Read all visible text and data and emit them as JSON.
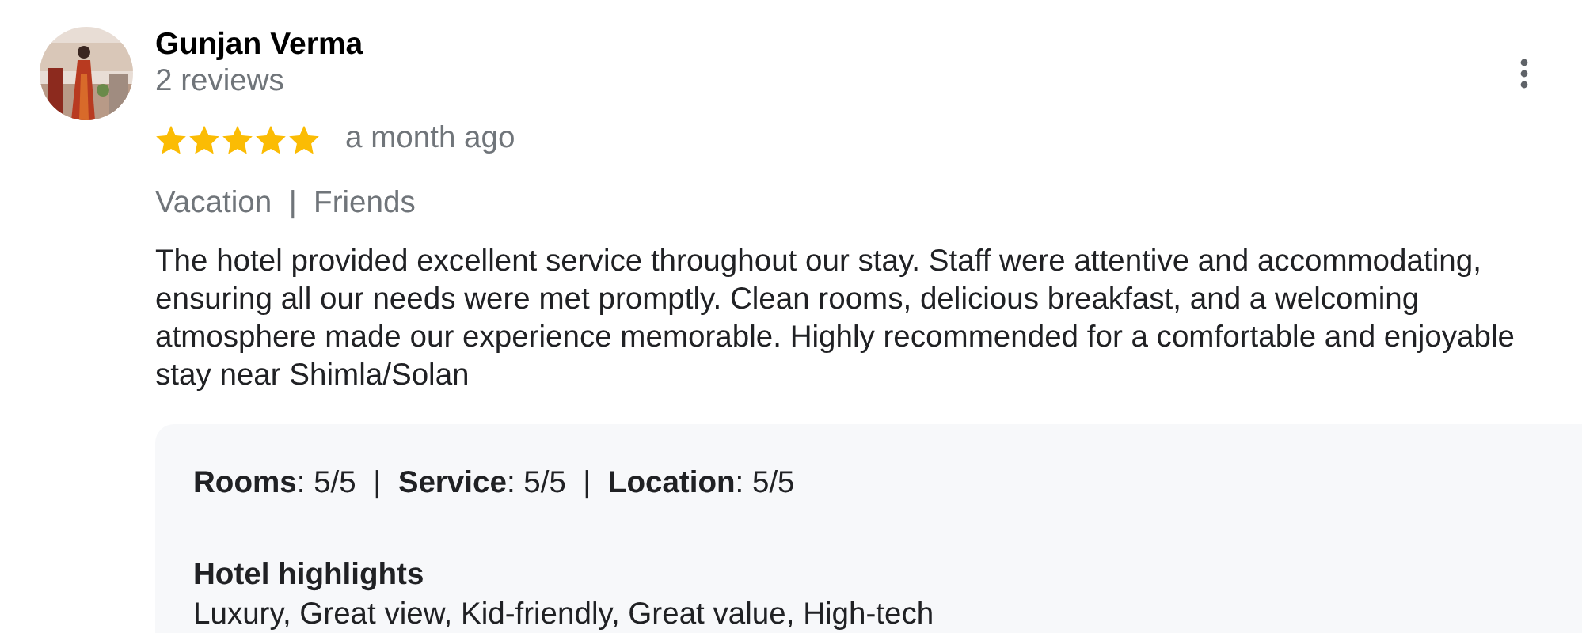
{
  "review": {
    "author": "Gunjan Verma",
    "review_count": "2 reviews",
    "stars": 5,
    "time": "a month ago",
    "trip": "Vacation  |  Friends",
    "text": "The hotel provided excellent service throughout our stay. Staff were attentive and accommodating, ensuring all our needs were met promptly. Clean rooms, delicious breakfast, and a welcoming atmosphere made our experience memorable. Highly recommended for a comfortable and enjoyable stay near Shimla/Solan",
    "ratings": "**Rooms**: 5/5  |  **Service**: 5/5  |  **Location**: 5/5",
    "highlights_title": "Hotel highlights",
    "highlights": "Luxury, Great view, Kid-friendly, Great value, High-tech"
  }
}
